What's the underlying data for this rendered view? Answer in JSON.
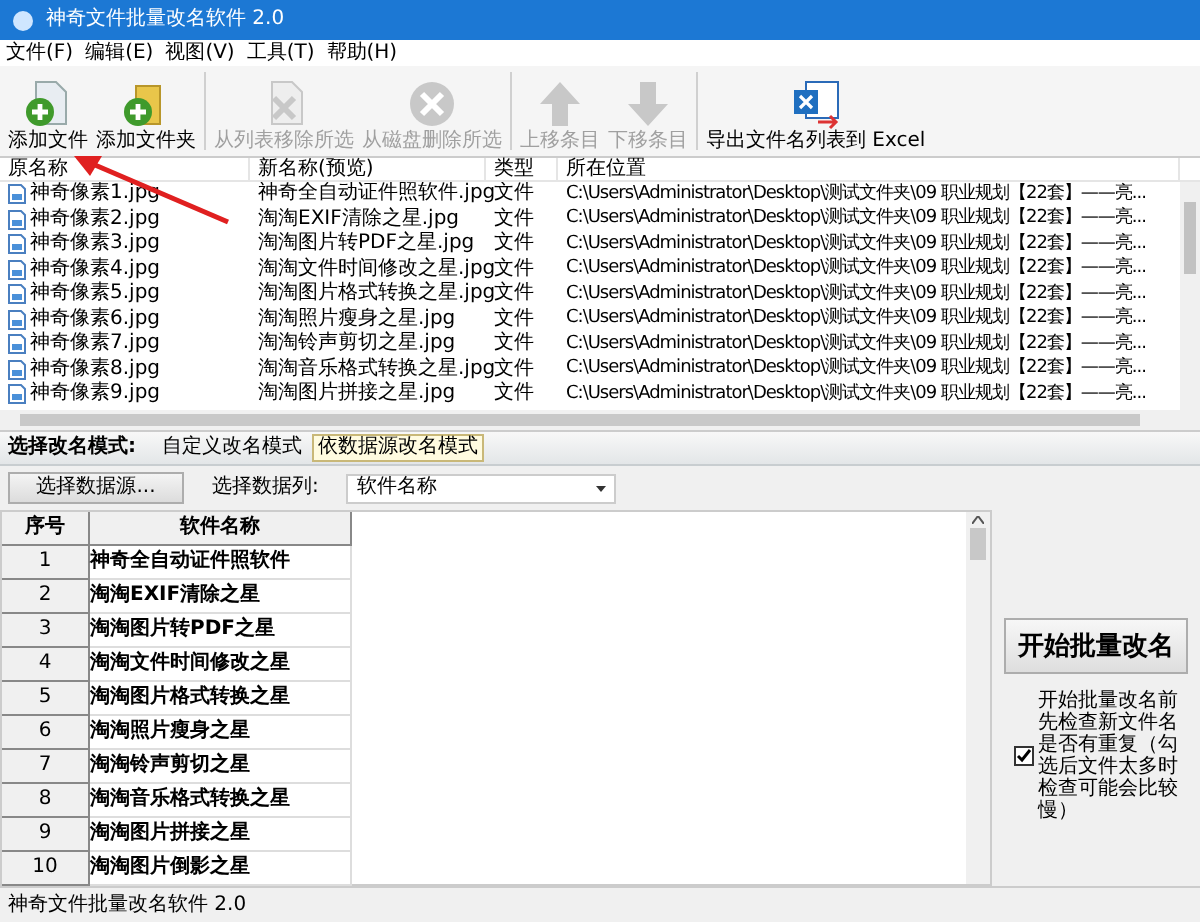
{
  "window": {
    "title": "神奇文件批量改名软件 2.0"
  },
  "menu": [
    "文件(F)",
    "编辑(E)",
    "视图(V)",
    "工具(T)",
    "帮助(H)"
  ],
  "toolbar": [
    {
      "kind": "add-file",
      "label": "添加文件",
      "disabled": false
    },
    {
      "kind": "add-folder",
      "label": "添加文件夹",
      "disabled": false
    },
    {
      "kind": "remove",
      "label": "从列表移除所选",
      "disabled": true
    },
    {
      "kind": "delete",
      "label": "从磁盘删除所选",
      "disabled": true
    },
    {
      "kind": "up",
      "label": "上移条目",
      "disabled": true
    },
    {
      "kind": "down",
      "label": "下移条目",
      "disabled": true
    },
    {
      "kind": "excel",
      "label": "导出文件名列表到 Excel",
      "disabled": false
    }
  ],
  "file_list": {
    "columns": [
      "原名称",
      "新名称(预览)",
      "类型",
      "所在位置"
    ],
    "rows": [
      [
        "神奇像素1.jpg",
        "神奇全自动证件照软件.jpg",
        "文件",
        "C:\\Users\\Administrator\\Desktop\\测试文件夹\\09 职业规划【22套】——亮..."
      ],
      [
        "神奇像素2.jpg",
        "淘淘EXIF清除之星.jpg",
        "文件",
        "C:\\Users\\Administrator\\Desktop\\测试文件夹\\09 职业规划【22套】——亮..."
      ],
      [
        "神奇像素3.jpg",
        "淘淘图片转PDF之星.jpg",
        "文件",
        "C:\\Users\\Administrator\\Desktop\\测试文件夹\\09 职业规划【22套】——亮..."
      ],
      [
        "神奇像素4.jpg",
        "淘淘文件时间修改之星.jpg",
        "文件",
        "C:\\Users\\Administrator\\Desktop\\测试文件夹\\09 职业规划【22套】——亮..."
      ],
      [
        "神奇像素5.jpg",
        "淘淘图片格式转换之星.jpg",
        "文件",
        "C:\\Users\\Administrator\\Desktop\\测试文件夹\\09 职业规划【22套】——亮..."
      ],
      [
        "神奇像素6.jpg",
        "淘淘照片瘦身之星.jpg",
        "文件",
        "C:\\Users\\Administrator\\Desktop\\测试文件夹\\09 职业规划【22套】——亮..."
      ],
      [
        "神奇像素7.jpg",
        "淘淘铃声剪切之星.jpg",
        "文件",
        "C:\\Users\\Administrator\\Desktop\\测试文件夹\\09 职业规划【22套】——亮..."
      ],
      [
        "神奇像素8.jpg",
        "淘淘音乐格式转换之星.jpg",
        "文件",
        "C:\\Users\\Administrator\\Desktop\\测试文件夹\\09 职业规划【22套】——亮..."
      ],
      [
        "神奇像素9.jpg",
        "淘淘图片拼接之星.jpg",
        "文件",
        "C:\\Users\\Administrator\\Desktop\\测试文件夹\\09 职业规划【22套】——亮..."
      ]
    ]
  },
  "mode": {
    "label": "选择改名模式:",
    "tabs": [
      {
        "label": "自定义改名模式",
        "selected": false
      },
      {
        "label": "依数据源改名模式",
        "selected": true
      }
    ]
  },
  "source": {
    "button": "选择数据源...",
    "column_label": "选择数据列:",
    "column_value": "软件名称"
  },
  "grid": {
    "columns": [
      "序号",
      "软件名称"
    ],
    "rows": [
      [
        "1",
        "神奇全自动证件照软件"
      ],
      [
        "2",
        "淘淘EXIF清除之星"
      ],
      [
        "3",
        "淘淘图片转PDF之星"
      ],
      [
        "4",
        "淘淘文件时间修改之星"
      ],
      [
        "5",
        "淘淘图片格式转换之星"
      ],
      [
        "6",
        "淘淘照片瘦身之星"
      ],
      [
        "7",
        "淘淘铃声剪切之星"
      ],
      [
        "8",
        "淘淘音乐格式转换之星"
      ],
      [
        "9",
        "淘淘图片拼接之星"
      ],
      [
        "10",
        "淘淘图片倒影之星"
      ]
    ]
  },
  "start_button": "开始批量改名",
  "check_option": {
    "label": "开始批量改名前先检查新文件名是否有重复（勾选后文件太多时检查可能会比较慢）",
    "checked": true
  },
  "status_bar": "神奇文件批量改名软件 2.0"
}
